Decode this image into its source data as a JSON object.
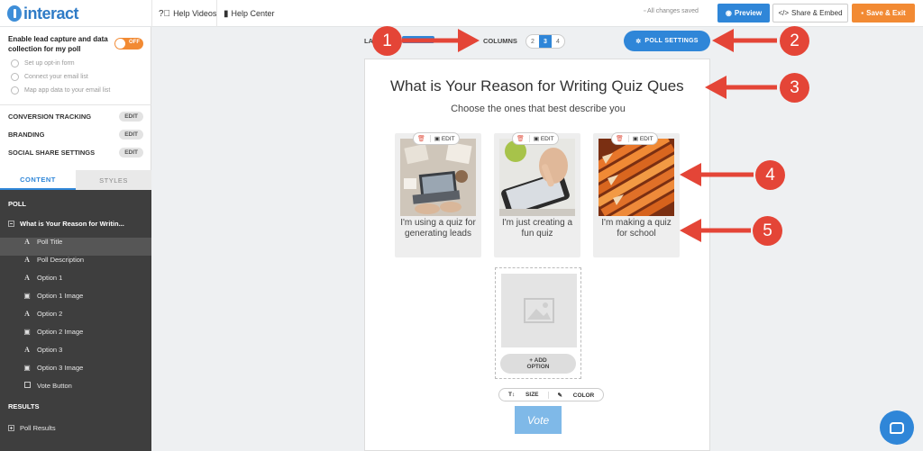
{
  "topbar": {
    "logo_text": "interact",
    "help_videos": "Help Videos",
    "help_center": "Help Center",
    "saved_status": "All changes saved",
    "preview_label": "Preview",
    "share_label": "Share & Embed",
    "save_exit_label": "Save & Exit"
  },
  "sidebar": {
    "lead_capture": "Enable lead capture and data collection for my poll",
    "toggle_state": "OFF",
    "lead_options": [
      "Set up opt-in form",
      "Connect your email list",
      "Map app data to your email list"
    ],
    "settings": [
      {
        "label": "CONVERSION TRACKING",
        "action": "EDIT"
      },
      {
        "label": "BRANDING",
        "action": "EDIT"
      },
      {
        "label": "SOCIAL SHARE SETTINGS",
        "action": "EDIT"
      }
    ],
    "tabs": [
      "CONTENT",
      "STYLES"
    ],
    "poll_heading": "POLL",
    "poll_selected": "What is Your Reason for Writin...",
    "poll_items": [
      {
        "icon": "text-icon",
        "glyph": "A",
        "label": "Poll Title"
      },
      {
        "icon": "text-icon",
        "glyph": "A",
        "label": "Poll Description"
      },
      {
        "icon": "text-icon",
        "glyph": "A",
        "label": "Option 1"
      },
      {
        "icon": "image-icon",
        "glyph": "▣",
        "label": "Option 1 Image"
      },
      {
        "icon": "text-icon",
        "glyph": "A",
        "label": "Option 2"
      },
      {
        "icon": "image-icon",
        "glyph": "▣",
        "label": "Option 2 Image"
      },
      {
        "icon": "text-icon",
        "glyph": "A",
        "label": "Option 3"
      },
      {
        "icon": "image-icon",
        "glyph": "▣",
        "label": "Option 3 Image"
      },
      {
        "icon": "checkbox-icon",
        "glyph": "",
        "label": "Vote Button"
      }
    ],
    "results_heading": "RESULTS",
    "results_item": "Poll Results"
  },
  "editor": {
    "layout_label": "LA",
    "columns_label": "COLUMNS",
    "column_options": [
      "2",
      "3",
      "4"
    ],
    "selected_columns": "3",
    "poll_settings": "POLL SETTINGS",
    "title": "What is Your Reason for Writing Quiz Ques",
    "description": "Choose the ones that best describe you",
    "edit_label": "EDIT",
    "options": [
      {
        "label": "I'm using a quiz for generating leads"
      },
      {
        "label": "I'm just creating a fun quiz"
      },
      {
        "label": "I'm making a quiz for school"
      }
    ],
    "add_option_line1": "ADD",
    "add_option_line2": "OPTION",
    "size_label": "SIZE",
    "color_label": "COLOR",
    "vote_label": "Vote"
  },
  "annotations": [
    "1",
    "2",
    "3",
    "4",
    "5"
  ],
  "colors": {
    "accent": "#2f86d8",
    "orange": "#f28a33",
    "annotation_red": "#e44537"
  }
}
